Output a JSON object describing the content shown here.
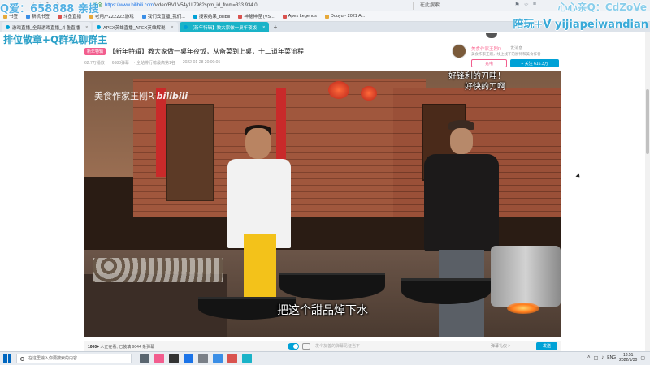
{
  "browser": {
    "url_secure_label": "安全",
    "url_host": "https://www.bilibili.com",
    "url_path": "/video/BV1V54y1L796?spm_id_from=333.934.0",
    "search_placeholder": "在此搜索",
    "bookmarks": [
      {
        "label": "书签",
        "color": "#e6a93a"
      },
      {
        "label": "新机书签",
        "color": "#3a8ee6"
      },
      {
        "label": "斗鱼直播",
        "color": "#d9534f"
      },
      {
        "label": "老用户ZZZZZZ游戏",
        "color": "#e6a93a"
      },
      {
        "label": "我们云直播_我们...",
        "color": "#3a8ee6"
      },
      {
        "label": "搜索结果_bilibili",
        "color": "#00a1d6"
      },
      {
        "label": "神秘神怪 (VS...",
        "color": "#d9534f"
      },
      {
        "label": "Apex Legends",
        "color": "#d9534f"
      },
      {
        "label": "Douyu - 2021 A...",
        "color": "#e6a93a"
      }
    ],
    "tabs": [
      {
        "label": "游戏直播_全部游戏直播_斗鱼直播",
        "active": false
      },
      {
        "label": "APEX英雄直播_APEX英雄解说",
        "active": false
      },
      {
        "label": "【新年特辑】教大家做一桌年夜饭",
        "active": true
      }
    ],
    "new_tab": "+"
  },
  "overlay": {
    "top_left": "Q爱：658888 亲搜",
    "top_right": "心心亲Q：CdZoVe",
    "left_promo": "排位散章+Q群私聊群主",
    "right_promo": "陪玩+V yijiapeiwandian"
  },
  "video": {
    "tag": "新年特辑",
    "title": "【新年特辑】教大家做一桌年夜饭，从备菜到上桌，十二道年菜流程",
    "views": "62.7万播放",
    "danmaku": "· 6688弹幕",
    "rank": "· 全站排行榜最高第1名",
    "date": "· 2022-01-28 20:00:05"
  },
  "uploader": {
    "name": "美食作家王刚R",
    "charge_label": "发消息",
    "description": "美食作家王刚，线上线下的厨师和美食作者",
    "charge_button": "充电",
    "follow_button": "+ 关注 616.3万"
  },
  "player": {
    "watermark": "美食作家王刚R",
    "watermark_logo": "bilibili",
    "caption_top_1": "好锋利的刀哇！",
    "caption_top_2": "好快的刀啊",
    "subtitle": "把这个甜品焯下水"
  },
  "controls": {
    "viewers_count": "1000+",
    "viewers_text": " 人正在看, 已装填 9044 条弹幕",
    "danmaku_placeholder": "发个友善的弹幕见证当下",
    "etiquette": "弹幕礼仪 >",
    "send": "发送"
  },
  "taskbar": {
    "search_placeholder": "在这里输入你要搜索的内容",
    "lang": "ENG",
    "time": "18:51",
    "date": "2022/1/30",
    "apps": [
      {
        "name": "task-view",
        "color": "#5a6670"
      },
      {
        "name": "bilibili-app",
        "color": "#f25d8e"
      },
      {
        "name": "app-dark",
        "color": "#333333"
      },
      {
        "name": "browser-app",
        "color": "#1a73e8"
      },
      {
        "name": "app-gray",
        "color": "#7a8088"
      },
      {
        "name": "app-blue",
        "color": "#3a8ee6"
      },
      {
        "name": "app-red",
        "color": "#d9534f"
      },
      {
        "name": "app-cyan",
        "color": "#1ab3c8"
      }
    ]
  },
  "colors": {
    "bilibili_blue": "#00a1d6",
    "bilibili_pink": "#f25d8e"
  }
}
